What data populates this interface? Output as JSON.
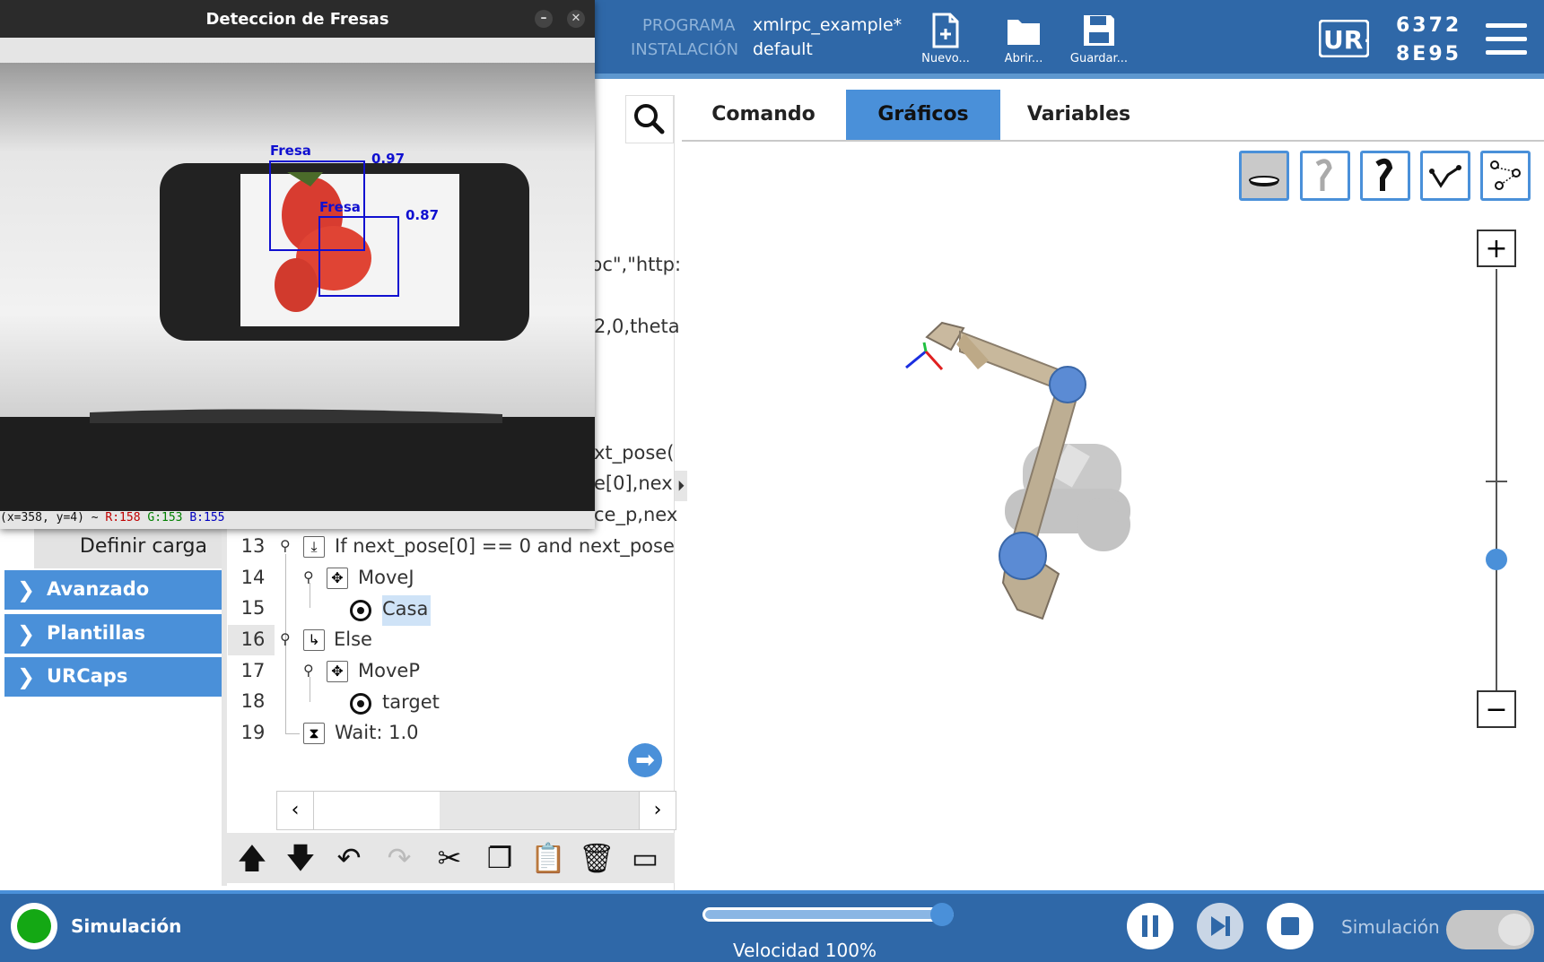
{
  "header": {
    "programa_label": "PROGRAMA",
    "programa_value": "xmlrpc_example*",
    "instalacion_label": "INSTALACIÓN",
    "instalacion_value": "default",
    "buttons": [
      {
        "label": "Nuevo...",
        "icon": "new-file-icon"
      },
      {
        "label": "Abrir...",
        "icon": "folder-icon"
      },
      {
        "label": "Guardar...",
        "icon": "save-icon"
      }
    ],
    "logo_text": "UR+",
    "serial_line1": "6372",
    "serial_line2": "8E95"
  },
  "camera_window": {
    "title": "Deteccion de Fresas",
    "detections": [
      {
        "label": "Fresa",
        "score": "0.97"
      },
      {
        "label": "Fresa",
        "score": "0.87"
      }
    ],
    "status_prefix": "(x=358, y=4) ~",
    "status_r": "R:158",
    "status_g": "G:153",
    "status_b": "B:155"
  },
  "left_panel": {
    "code_fragments": [
      "pc\",\"http:",
      "2,0,theta",
      "xt_pose(",
      "e[0],nex",
      "ce_p,nex"
    ],
    "define_load": "Definir carga",
    "nav": [
      {
        "label": "Avanzado"
      },
      {
        "label": "Plantillas"
      },
      {
        "label": "URCaps"
      }
    ]
  },
  "program_tree": {
    "lines": [
      {
        "num": "13",
        "text": "If next_pose[0] == 0 and next_pose",
        "icon": "if-icon"
      },
      {
        "num": "14",
        "text": "MoveJ",
        "icon": "move-icon"
      },
      {
        "num": "15",
        "text": "Casa",
        "icon": "waypoint-icon"
      },
      {
        "num": "16",
        "text": "Else",
        "icon": "else-icon"
      },
      {
        "num": "17",
        "text": "MoveP",
        "icon": "move-icon"
      },
      {
        "num": "18",
        "text": "target",
        "icon": "waypoint-icon"
      },
      {
        "num": "19",
        "text": "Wait: 1.0",
        "icon": "hourglass-icon"
      }
    ]
  },
  "tabs": [
    {
      "label": "Comando"
    },
    {
      "label": "Gráficos"
    },
    {
      "label": "Variables"
    }
  ],
  "footer": {
    "mode_label": "Simulación",
    "speed_label": "Velocidad 100%",
    "speed_value": 1.0,
    "toggle_label": "Simulación"
  },
  "colors": {
    "header_blue": "#2f68a8",
    "accent_blue": "#4a90d9",
    "status_green": "#14a814",
    "detection_box": "#1010d0"
  }
}
